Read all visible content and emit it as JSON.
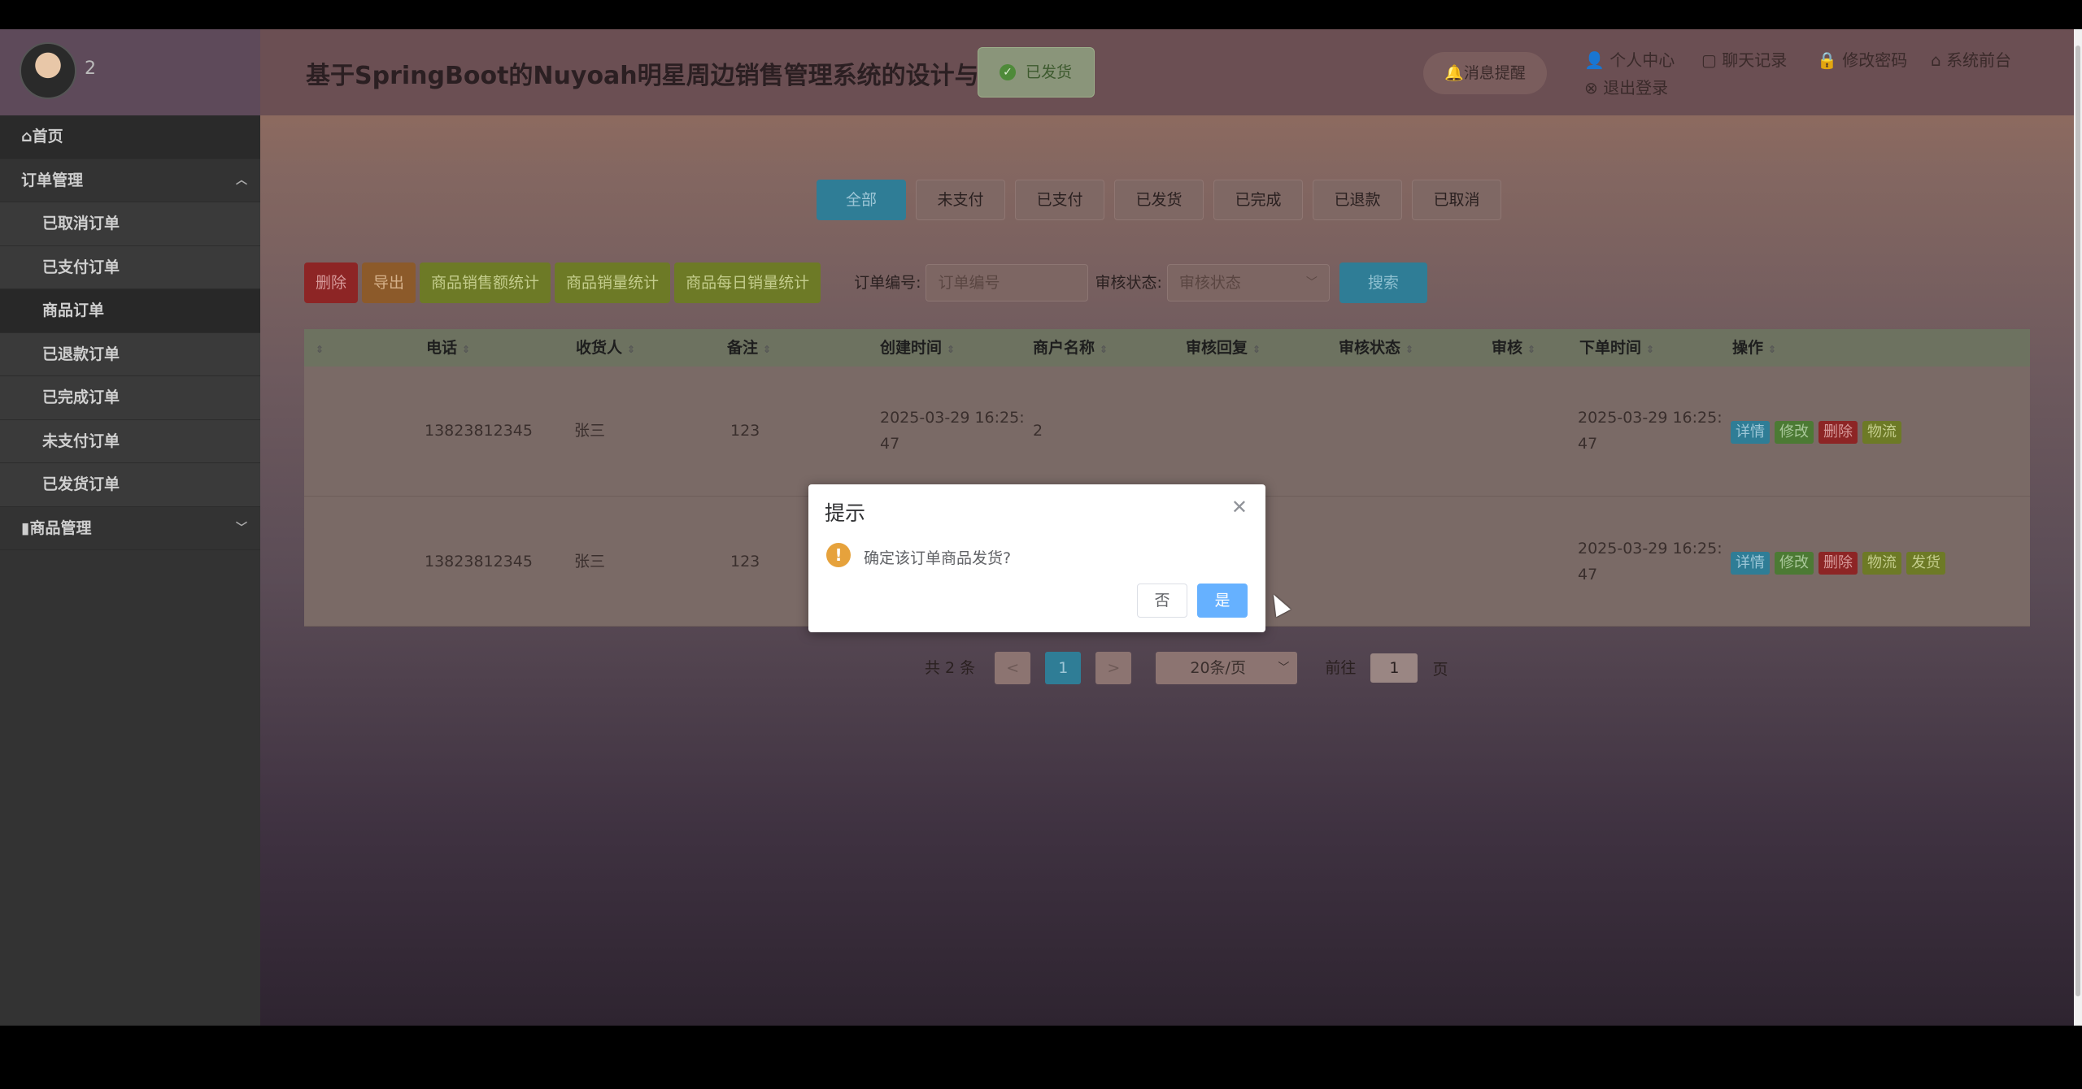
{
  "user": {
    "name": "2"
  },
  "header": {
    "title": "基于SpringBoot的Nuyoah明星周边销售管理系统的设计与实现",
    "toast": "已发货",
    "notify": "消息提醒",
    "links": [
      "个人中心",
      "聊天记录",
      "修改密码",
      "系统前台",
      "退出登录"
    ]
  },
  "sidebar": {
    "home": "首页",
    "order_group": "订单管理",
    "order_items": [
      "已取消订单",
      "已支付订单",
      "商品订单",
      "已退款订单",
      "已完成订单",
      "未支付订单",
      "已发货订单"
    ],
    "goods_group": "商品管理"
  },
  "tabs": [
    "全部",
    "未支付",
    "已支付",
    "已发货",
    "已完成",
    "已退款",
    "已取消"
  ],
  "toolbar": {
    "delete": "删除",
    "export": "导出",
    "stat_amount": "商品销售额统计",
    "stat_volume": "商品销量统计",
    "stat_daily": "商品每日销量统计",
    "order_no_label": "订单编号:",
    "order_no_placeholder": "订单编号",
    "audit_label": "审核状态:",
    "audit_placeholder": "审核状态",
    "search": "搜索"
  },
  "table": {
    "headers": [
      "电话",
      "收货人",
      "备注",
      "创建时间",
      "商户名称",
      "审核回复",
      "审核状态",
      "审核",
      "下单时间",
      "操作"
    ],
    "rows": [
      {
        "phone": "13823812345",
        "receiver": "张三",
        "remark": "123",
        "created": "2025-03-29 16:25:",
        "created2": "47",
        "merchant": "2",
        "ordered": "2025-03-29 16:25:",
        "ordered2": "47"
      },
      {
        "phone": "13823812345",
        "receiver": "张三",
        "remark": "123",
        "ordered": "2025-03-29 16:25:",
        "ordered2": "47"
      }
    ],
    "ops": {
      "detail": "详情",
      "edit": "修改",
      "delete": "删除",
      "logistics": "物流",
      "ship": "发货"
    }
  },
  "pager": {
    "total": "共 2 条",
    "prev": "<",
    "page": "1",
    "next": ">",
    "size": "20条/页",
    "goto": "前往",
    "input": "1",
    "unit": "页"
  },
  "dialog": {
    "title": "提示",
    "message": "确定该订单商品发货?",
    "no": "否",
    "yes": "是"
  }
}
